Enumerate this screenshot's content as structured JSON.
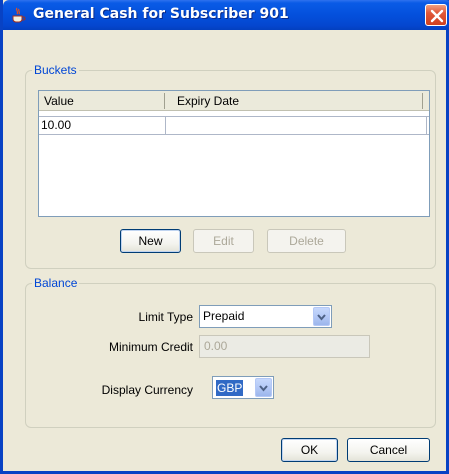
{
  "window": {
    "title": "General Cash for Subscriber 901",
    "icon": "java-cup-icon",
    "close_icon": "close-icon"
  },
  "buckets": {
    "group_label": "Buckets",
    "columns": [
      "Value",
      "Expiry Date"
    ],
    "rows": [
      {
        "value": "10.00",
        "expiry": ""
      }
    ],
    "buttons": {
      "new": "New",
      "edit": "Edit",
      "delete": "Delete"
    }
  },
  "balance": {
    "group_label": "Balance",
    "limit_type": {
      "label": "Limit Type",
      "value": "Prepaid"
    },
    "minimum_credit": {
      "label": "Minimum Credit",
      "value": "0.00"
    },
    "display_currency": {
      "label": "Display Currency",
      "value": "GBP"
    }
  },
  "footer": {
    "ok": "OK",
    "cancel": "Cancel"
  },
  "colors": {
    "titlebar": "#0450dc",
    "group_label": "#0046d5",
    "selection": "#316ac5"
  }
}
